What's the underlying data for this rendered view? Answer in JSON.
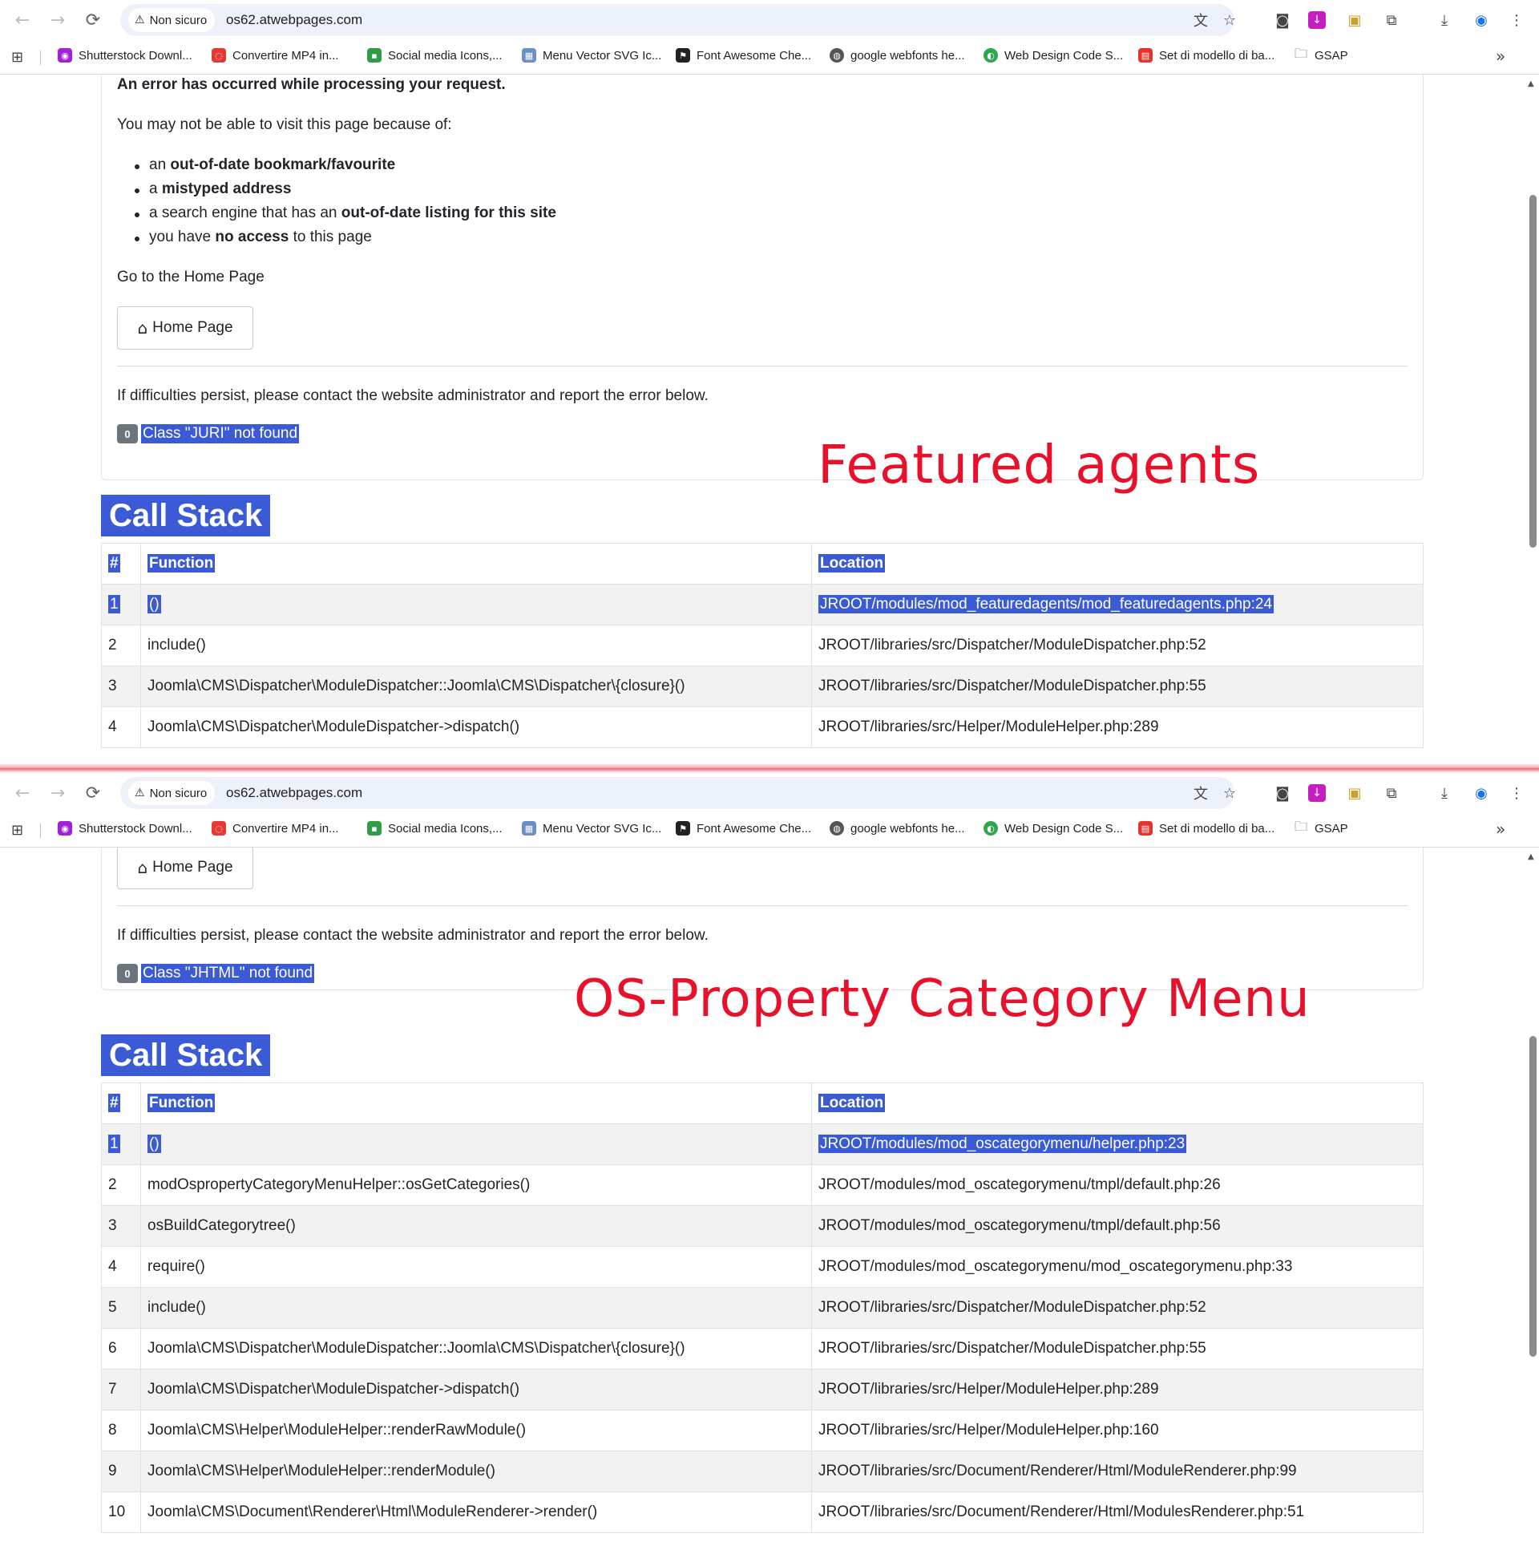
{
  "browser": {
    "security_label": "Non sicuro",
    "url": "os62.atwebpages.com",
    "bookmarks": [
      {
        "label": "Shutterstock Downl...",
        "color": "#a021d8"
      },
      {
        "label": "Convertire MP4 in...",
        "color": "#e53935"
      },
      {
        "label": "Social media Icons,...",
        "color": "#2e9d46"
      },
      {
        "label": "Menu Vector SVG Ic...",
        "color": "#6b8fc7"
      },
      {
        "label": "Font Awesome Che...",
        "color": "#222222"
      },
      {
        "label": "google webfonts he...",
        "color": "#555555"
      },
      {
        "label": "Web Design Code S...",
        "color": "#2ea64d"
      },
      {
        "label": "Set di modello di ba...",
        "color": "#e5342d"
      },
      {
        "label": "GSAP",
        "color": "#444444"
      }
    ]
  },
  "top": {
    "heading": "An error has occurred while processing your request.",
    "intro": "You may not be able to visit this page because of:",
    "reasons": [
      {
        "pre": "an ",
        "bold": "out-of-date bookmark/favourite",
        "post": ""
      },
      {
        "pre": "a ",
        "bold": "mistyped address",
        "post": ""
      },
      {
        "pre": "a search engine that has an ",
        "bold": "out-of-date listing for this site",
        "post": ""
      },
      {
        "pre": "you have ",
        "bold": "no access",
        "post": " to this page"
      }
    ],
    "go_home": "Go to the Home Page",
    "home_button": "Home Page",
    "contact": "If difficulties persist, please contact the website administrator and report the error below.",
    "error_code": "0",
    "error_message": "Class \"JURI\" not found",
    "annotation": "Featured agents",
    "call_stack_title": "Call Stack",
    "columns": [
      "#",
      "Function",
      "Location"
    ],
    "rows": [
      [
        "1",
        "()",
        "JROOT/modules/mod_featuredagents/mod_featuredagents.php:24"
      ],
      [
        "2",
        "include()",
        "JROOT/libraries/src/Dispatcher/ModuleDispatcher.php:52"
      ],
      [
        "3",
        "Joomla\\CMS\\Dispatcher\\ModuleDispatcher::Joomla\\CMS\\Dispatcher\\{closure}()",
        "JROOT/libraries/src/Dispatcher/ModuleDispatcher.php:55"
      ],
      [
        "4",
        "Joomla\\CMS\\Dispatcher\\ModuleDispatcher->dispatch()",
        "JROOT/libraries/src/Helper/ModuleHelper.php:289"
      ]
    ]
  },
  "bottom": {
    "home_button": "Home Page",
    "contact": "If difficulties persist, please contact the website administrator and report the error below.",
    "error_code": "0",
    "error_message": "Class \"JHTML\" not found",
    "annotation": "OS-Property Category Menu",
    "call_stack_title": "Call Stack",
    "columns": [
      "#",
      "Function",
      "Location"
    ],
    "rows": [
      [
        "1",
        "()",
        "JROOT/modules/mod_oscategorymenu/helper.php:23"
      ],
      [
        "2",
        "modOspropertyCategoryMenuHelper::osGetCategories()",
        "JROOT/modules/mod_oscategorymenu/tmpl/default.php:26"
      ],
      [
        "3",
        "osBuildCategorytree()",
        "JROOT/modules/mod_oscategorymenu/tmpl/default.php:56"
      ],
      [
        "4",
        "require()",
        "JROOT/modules/mod_oscategorymenu/mod_oscategorymenu.php:33"
      ],
      [
        "5",
        "include()",
        "JROOT/libraries/src/Dispatcher/ModuleDispatcher.php:52"
      ],
      [
        "6",
        "Joomla\\CMS\\Dispatcher\\ModuleDispatcher::Joomla\\CMS\\Dispatcher\\{closure}()",
        "JROOT/libraries/src/Dispatcher/ModuleDispatcher.php:55"
      ],
      [
        "7",
        "Joomla\\CMS\\Dispatcher\\ModuleDispatcher->dispatch()",
        "JROOT/libraries/src/Helper/ModuleHelper.php:289"
      ],
      [
        "8",
        "Joomla\\CMS\\Helper\\ModuleHelper::renderRawModule()",
        "JROOT/libraries/src/Helper/ModuleHelper.php:160"
      ],
      [
        "9",
        "Joomla\\CMS\\Helper\\ModuleHelper::renderModule()",
        "JROOT/libraries/src/Document/Renderer/Html/ModuleRenderer.php:99"
      ],
      [
        "10",
        "Joomla\\CMS\\Document\\Renderer\\Html\\ModuleRenderer->render()",
        "JROOT/libraries/src/Document/Renderer/Html/ModulesRenderer.php:51"
      ]
    ]
  },
  "colors": {
    "selection": "#3b5bd6",
    "annotation": "#e8102a",
    "badge": "#6c757d"
  }
}
